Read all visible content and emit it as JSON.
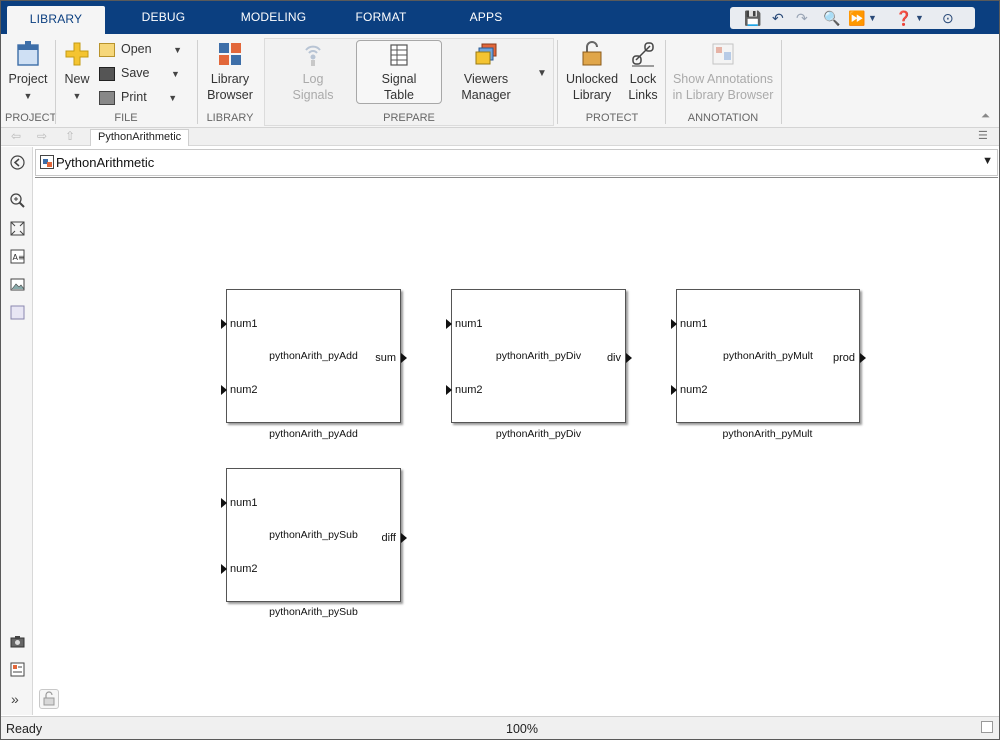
{
  "tabs": [
    "LIBRARY",
    "DEBUG",
    "MODELING",
    "FORMAT",
    "APPS"
  ],
  "ribbon": {
    "project": {
      "label": "Project",
      "group": "PROJECT"
    },
    "file": {
      "new": "New",
      "open": "Open",
      "save": "Save",
      "print": "Print",
      "group": "FILE"
    },
    "library": {
      "browser_line1": "Library",
      "browser_line2": "Browser",
      "group": "LIBRARY"
    },
    "prepare": {
      "log_line1": "Log",
      "log_line2": "Signals",
      "signal_line1": "Signal",
      "signal_line2": "Table",
      "viewers_line1": "Viewers",
      "viewers_line2": "Manager",
      "group": "PREPARE"
    },
    "protect": {
      "unlocked_line1": "Unlocked",
      "unlocked_line2": "Library",
      "lock_line1": "Lock",
      "lock_line2": "Links",
      "group": "PROTECT"
    },
    "annotation": {
      "line1": "Show Annotations",
      "line2": "in Library Browser",
      "group": "ANNOTATION"
    }
  },
  "breadcrumb": {
    "tab": "PythonArithmetic"
  },
  "address": {
    "model_name": "PythonArithmetic"
  },
  "blocks": [
    {
      "title": "pythonArith_pyAdd",
      "in1": "num1",
      "in2": "num2",
      "out": "sum",
      "label": "pythonArith_pyAdd"
    },
    {
      "title": "pythonArith_pyDiv",
      "in1": "num1",
      "in2": "num2",
      "out": "div",
      "label": "pythonArith_pyDiv"
    },
    {
      "title": "pythonArith_pyMult",
      "in1": "num1",
      "in2": "num2",
      "out": "prod",
      "label": "pythonArith_pyMult"
    },
    {
      "title": "pythonArith_pySub",
      "in1": "num1",
      "in2": "num2",
      "out": "diff",
      "label": "pythonArith_pySub"
    }
  ],
  "status": {
    "state": "Ready",
    "zoom": "100%"
  },
  "colors": {
    "tabstrip": "#0b3f80",
    "ribbon": "#f5f5f5"
  }
}
